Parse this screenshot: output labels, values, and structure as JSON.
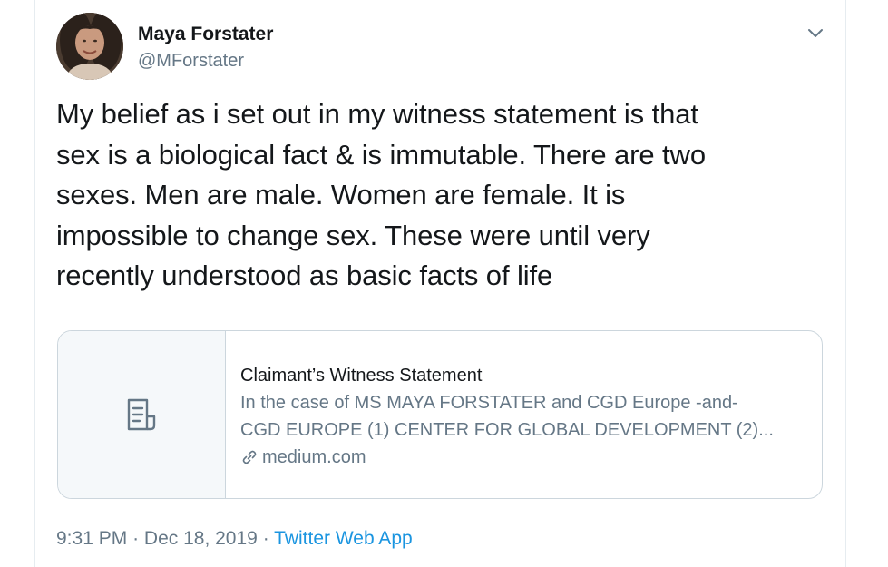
{
  "author": {
    "display_name": "Maya Forstater",
    "handle": "@MForstater"
  },
  "tweet": {
    "lines": [
      "My belief as i set out in my witness statement is that",
      "sex is a biological fact & is immutable. There are two",
      "sexes. Men are male. Women are female. It is",
      "impossible to change sex. These were until very",
      "recently understood as basic facts of life"
    ]
  },
  "card": {
    "title": "Claimant’s Witness Statement",
    "description_lines": [
      "In the case of MS MAYA FORSTATER and CGD Europe -and-",
      "CGD EUROPE (1) CENTER FOR GLOBAL DEVELOPMENT (2)..."
    ],
    "domain": "medium.com",
    "thumb_icon": "document-icon"
  },
  "meta": {
    "time": "9:31 PM",
    "separator": "·",
    "date": "Dec 18, 2019",
    "source": "Twitter Web App"
  },
  "colors": {
    "text": "#14171a",
    "secondary": "#657786",
    "link": "#1b95e0",
    "border": "#ccd6dd"
  }
}
